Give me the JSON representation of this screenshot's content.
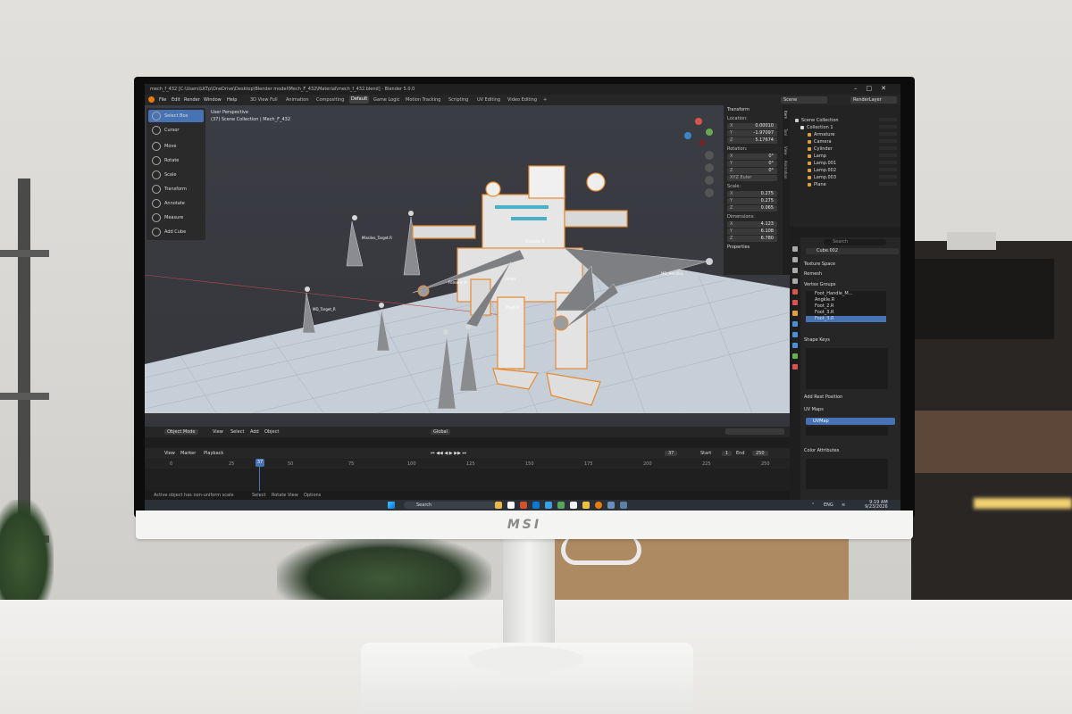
{
  "window": {
    "title": "mech_f_432 [C:\\Users\\LKTp\\OneDrive\\Desktop\\Blender model\\Mech_F_432\\Material\\mech_f_432.blend] - Blender 5.0.0",
    "controls": [
      "–",
      "□",
      "✕"
    ]
  },
  "menubar": {
    "items": [
      "File",
      "Edit",
      "Render",
      "Window",
      "Help"
    ],
    "workspaces": [
      "3D View Full",
      "Animation",
      "Compositing",
      "Default",
      "Game Logic",
      "Motion Tracking",
      "Scripting",
      "UV Editing",
      "Video Editing"
    ],
    "active_workspace": "Default",
    "add_tab": "+",
    "scene_field": "Scene",
    "view_layer_field": "RenderLayer"
  },
  "toolbar": {
    "tools": [
      {
        "label": "Select Box",
        "icon": "select-box-icon",
        "active": true
      },
      {
        "label": "Cursor",
        "icon": "cursor-icon"
      },
      {
        "label": "Move",
        "icon": "move-icon"
      },
      {
        "label": "Rotate",
        "icon": "rotate-icon"
      },
      {
        "label": "Scale",
        "icon": "scale-icon"
      },
      {
        "label": "Transform",
        "icon": "transform-icon"
      },
      {
        "label": "Annotate",
        "icon": "annotate-icon"
      },
      {
        "label": "Measure",
        "icon": "measure-icon"
      },
      {
        "label": "Add Cube",
        "icon": "add-cube-icon"
      }
    ]
  },
  "viewport": {
    "perspective": "User Perspective",
    "collection": "(37) Scene Collection | Mech_F_432",
    "labels": {
      "missiles_target": "Missiles_Target.R",
      "md_target": "MD_Target_R",
      "md_handle": "MD_HandleL",
      "shoulder": "Shoulder.R",
      "forearm": "Forearm.R",
      "thigh": "Thigh.R",
      "pelvis": "Pelvis"
    },
    "header": {
      "mode": "Object Mode",
      "menus": [
        "View",
        "Select",
        "Add",
        "Object"
      ],
      "orientation": "Global"
    }
  },
  "n_panel": {
    "section": "Transform",
    "location_label": "Location:",
    "location": [
      {
        "axis": "X",
        "value": "0.00010"
      },
      {
        "axis": "Y",
        "value": "-1.97097"
      },
      {
        "axis": "Z",
        "value": "5.17674"
      }
    ],
    "rotation_label": "Rotation:",
    "rotation": [
      {
        "axis": "X",
        "value": "0°"
      },
      {
        "axis": "Y",
        "value": "0°"
      },
      {
        "axis": "Z",
        "value": "0°"
      }
    ],
    "rotation_mode": "XYZ Euler",
    "scale_label": "Scale:",
    "scale": [
      {
        "axis": "X",
        "value": "0.275"
      },
      {
        "axis": "Y",
        "value": "0.275"
      },
      {
        "axis": "Z",
        "value": "0.065"
      }
    ],
    "dimensions_label": "Dimensions:",
    "dimensions": [
      {
        "axis": "X",
        "value": "4.123"
      },
      {
        "axis": "Y",
        "value": "6.108"
      },
      {
        "axis": "Z",
        "value": "6.780"
      }
    ],
    "properties_label": "Properties",
    "side_tabs": [
      "Item",
      "Tool",
      "View",
      "Animation"
    ]
  },
  "timeline": {
    "menus": [
      "View",
      "Marker",
      "Playback"
    ],
    "current_frame": "37",
    "start_label": "Start",
    "start": "1",
    "end_label": "End",
    "end": "250",
    "ruler": [
      "0",
      "25",
      "37",
      "50",
      "75",
      "100",
      "125",
      "150",
      "175",
      "200",
      "225",
      "250"
    ]
  },
  "statusbar": {
    "message": "Active object has non-uniform scale",
    "hints": [
      "Select",
      "Rotate View",
      "Options"
    ],
    "version": "5.0.0"
  },
  "outliner": {
    "root": "Scene Collection",
    "collection": "Collection 1",
    "items": [
      "Armature",
      "Camera",
      "Cylinder",
      "Lamp",
      "Lamp.001",
      "Lamp.002",
      "Lamp.003",
      "Plane"
    ]
  },
  "properties": {
    "search_placeholder": "Search",
    "object_name": "Cube.002",
    "sections": {
      "texture_space": "Texture Space",
      "remesh": "Remesh",
      "vertex_groups": "Vertex Groups",
      "shape_keys": "Shape Keys",
      "add_rest_position": "Add Rest Position",
      "uv_maps": "UV Maps",
      "color_attributes": "Color Attributes"
    },
    "vertex_groups": [
      "Foot_Handle_M...",
      "Angkle.R",
      "Foot_2.R",
      "Foot_3.R",
      "Foot_3.R"
    ],
    "selected_vertex_group": 4,
    "uv_map": "UVMap"
  },
  "taskbar": {
    "search": "Search",
    "language": "ENG",
    "time": "9:19 AM",
    "date": "9/23/2026"
  },
  "monitor": {
    "brand": "msi"
  },
  "colors": {
    "accent": "#4772b3",
    "selection_orange": "#e88a2e",
    "viewport_bg": "#3b3d44",
    "floor": "#c9d1da"
  }
}
